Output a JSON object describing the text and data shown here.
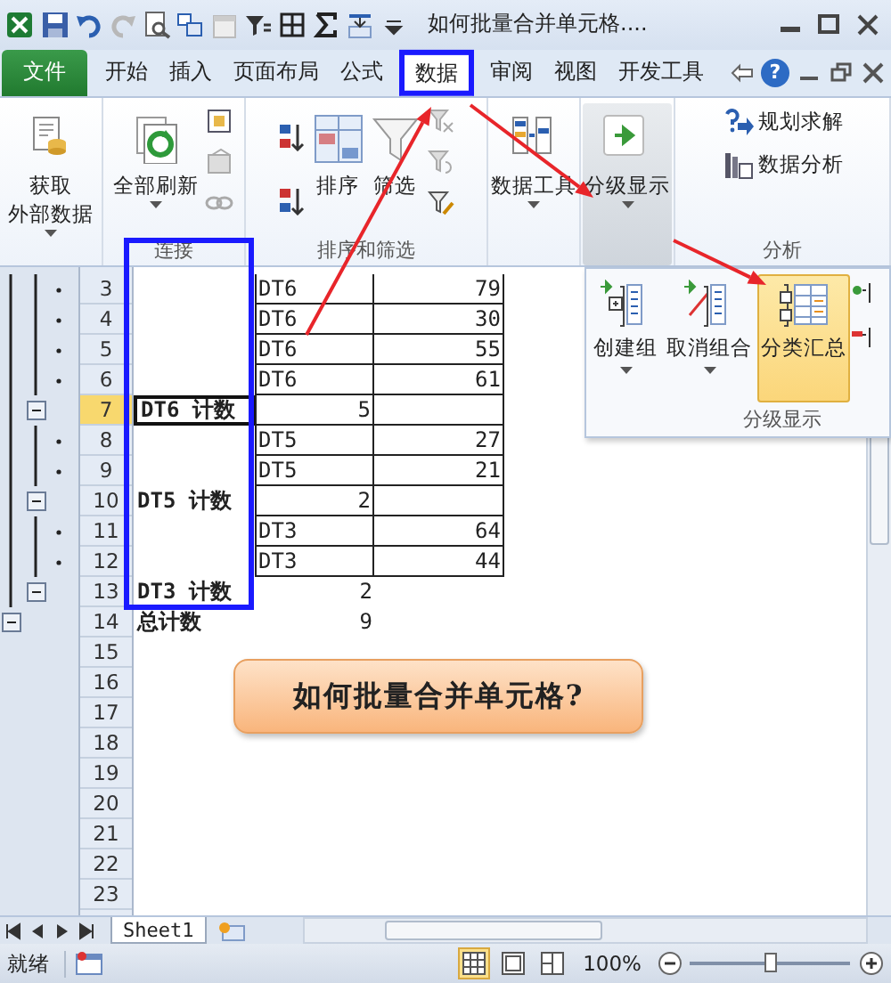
{
  "title_bar": {
    "title": "如何批量合并单元格...."
  },
  "tabs": [
    {
      "label": "文件",
      "kind": "file",
      "selected": false
    },
    {
      "label": "开始",
      "kind": "tab",
      "selected": false
    },
    {
      "label": "插入",
      "kind": "tab",
      "selected": false
    },
    {
      "label": "页面布局",
      "kind": "tab",
      "selected": false
    },
    {
      "label": "公式",
      "kind": "tab",
      "selected": false
    },
    {
      "label": "数据",
      "kind": "tab",
      "selected": true
    },
    {
      "label": "审阅",
      "kind": "tab",
      "selected": false
    },
    {
      "label": "视图",
      "kind": "tab",
      "selected": false
    },
    {
      "label": "开发工具",
      "kind": "tab",
      "selected": false
    }
  ],
  "help_label": "?",
  "ribbon": {
    "groups": [
      {
        "kind": "external",
        "buttons": [
          {
            "lines": [
              "获取",
              "外部数据"
            ],
            "dropdown": true
          }
        ]
      },
      {
        "kind": "connections",
        "label": "连接",
        "buttons": [
          {
            "lines": [
              "全部刷新"
            ],
            "dropdown": true
          }
        ]
      },
      {
        "kind": "sort",
        "label": "排序和筛选",
        "buttons": [
          {
            "lines": [
              "排序"
            ],
            "dropdown": false
          },
          {
            "lines": [
              "筛选"
            ],
            "dropdown": false
          }
        ]
      },
      {
        "kind": "tools",
        "buttons": [
          {
            "lines": [
              "数据工具"
            ],
            "dropdown": true
          }
        ]
      },
      {
        "kind": "outline",
        "buttons": [
          {
            "lines": [
              "分级显示"
            ],
            "dropdown": true,
            "open": true
          }
        ]
      },
      {
        "kind": "analysis",
        "label": "分析",
        "buttons": [
          {
            "lines": [
              "规划求解"
            ],
            "dropdown": false
          },
          {
            "lines": [
              "数据分析"
            ],
            "dropdown": false
          }
        ]
      }
    ]
  },
  "outline_menu": {
    "label": "分级显示",
    "items": [
      {
        "label": "创建组",
        "dropdown": true,
        "selected": false
      },
      {
        "label": "取消组合",
        "dropdown": true,
        "selected": false
      },
      {
        "label": "分类汇总",
        "dropdown": false,
        "selected": true
      }
    ]
  },
  "sheet": {
    "rows": [
      {
        "number": "3",
        "kind": "detail",
        "outline": {
          "kind": "detail"
        },
        "bordered": true,
        "selected": false,
        "b": "DT6",
        "c": "79"
      },
      {
        "number": "4",
        "kind": "detail",
        "outline": {
          "kind": "detail"
        },
        "bordered": true,
        "selected": false,
        "b": "DT6",
        "c": "30"
      },
      {
        "number": "5",
        "kind": "detail",
        "outline": {
          "kind": "detail"
        },
        "bordered": true,
        "selected": false,
        "b": "DT6",
        "c": "55"
      },
      {
        "number": "6",
        "kind": "detail",
        "outline": {
          "kind": "detail"
        },
        "bordered": true,
        "selected": false,
        "b": "DT6",
        "c": "61"
      },
      {
        "number": "7",
        "kind": "subtotal",
        "outline": {
          "kind": "group"
        },
        "bordered": true,
        "selected": true,
        "a": "DT6 计数",
        "b": "5"
      },
      {
        "number": "8",
        "kind": "detail",
        "outline": {
          "kind": "detail"
        },
        "bordered": true,
        "selected": false,
        "b": "DT5",
        "c": "27"
      },
      {
        "number": "9",
        "kind": "detail",
        "outline": {
          "kind": "detail"
        },
        "bordered": true,
        "selected": false,
        "b": "DT5",
        "c": "21"
      },
      {
        "number": "10",
        "kind": "subtotal",
        "outline": {
          "kind": "group"
        },
        "bordered": true,
        "selected": false,
        "a": "DT5 计数",
        "b": "2"
      },
      {
        "number": "11",
        "kind": "detail",
        "outline": {
          "kind": "detail"
        },
        "bordered": true,
        "selected": false,
        "b": "DT3",
        "c": "64"
      },
      {
        "number": "12",
        "kind": "detail",
        "outline": {
          "kind": "detail"
        },
        "bordered": true,
        "selected": false,
        "b": "DT3",
        "c": "44"
      },
      {
        "number": "13",
        "kind": "subtotal",
        "outline": {
          "kind": "group"
        },
        "bordered": false,
        "selected": false,
        "a": "DT3 计数",
        "b": "2"
      },
      {
        "number": "14",
        "kind": "total",
        "outline": {
          "kind": "total"
        },
        "bordered": false,
        "selected": false,
        "a": "总计数",
        "b": "9"
      },
      {
        "number": "15",
        "kind": "empty",
        "selected": false
      },
      {
        "number": "16",
        "kind": "empty",
        "selected": false
      },
      {
        "number": "17",
        "kind": "empty",
        "selected": false
      },
      {
        "number": "18",
        "kind": "empty",
        "selected": false
      },
      {
        "number": "19",
        "kind": "empty",
        "selected": false
      },
      {
        "number": "20",
        "kind": "empty",
        "selected": false
      },
      {
        "number": "21",
        "kind": "empty",
        "selected": false
      },
      {
        "number": "22",
        "kind": "empty",
        "selected": false
      },
      {
        "number": "23",
        "kind": "empty",
        "selected": false
      }
    ]
  },
  "callout": {
    "text": "如何批量合并单元格?"
  },
  "sheet_tabs": [
    {
      "label": "Sheet1",
      "selected": true
    }
  ],
  "status_bar": {
    "status": "就绪",
    "views": [
      {
        "selected": true
      },
      {
        "selected": false
      },
      {
        "selected": false
      }
    ],
    "zoom": "100%",
    "zoom_slider": {
      "level": 0.5
    }
  }
}
